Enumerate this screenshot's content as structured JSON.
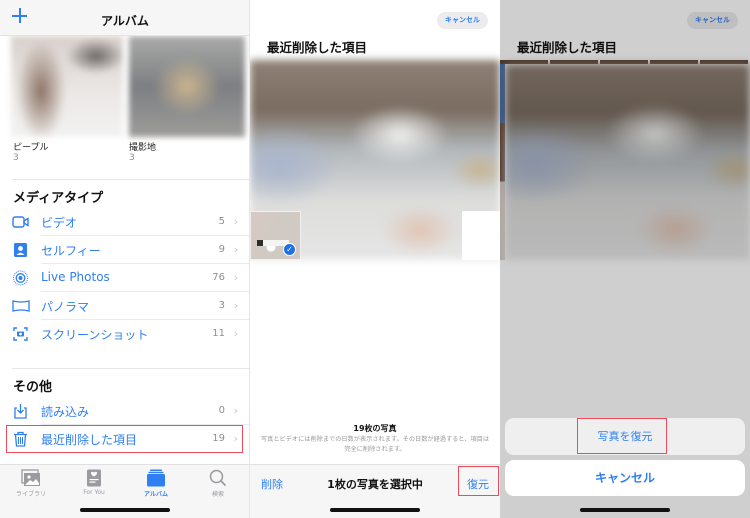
{
  "panel1": {
    "nav": {
      "title": "アルバム",
      "add_icon": "plus-icon"
    },
    "albums": [
      {
        "label": "ピープル",
        "count": "3"
      },
      {
        "label": "撮影地",
        "count": "3"
      }
    ],
    "media_types": {
      "title": "メディアタイプ",
      "items": [
        {
          "icon": "video-icon",
          "label": "ビデオ",
          "count": "5"
        },
        {
          "icon": "selfie-icon",
          "label": "セルフィー",
          "count": "9"
        },
        {
          "icon": "live-photos-icon",
          "label": "Live Photos",
          "count": "76"
        },
        {
          "icon": "panorama-icon",
          "label": "パノラマ",
          "count": "3"
        },
        {
          "icon": "screenshot-icon",
          "label": "スクリーンショット",
          "count": "11"
        }
      ]
    },
    "other": {
      "title": "その他",
      "items": [
        {
          "icon": "import-icon",
          "label": "読み込み",
          "count": "0"
        },
        {
          "icon": "trash-icon",
          "label": "最近削除した項目",
          "count": "19",
          "highlighted": true
        }
      ]
    },
    "tabbar": [
      {
        "icon": "library-icon",
        "label": "ライブラリ",
        "active": false
      },
      {
        "icon": "for-you-icon",
        "label": "For You",
        "active": false
      },
      {
        "icon": "albums-icon",
        "label": "アルバム",
        "active": true
      },
      {
        "icon": "search-icon",
        "label": "検索",
        "active": false
      }
    ],
    "chevron": "›"
  },
  "panel2": {
    "cancel_label": "キャンセル",
    "title": "最近削除した項目",
    "selected_check": "✓",
    "summary_title": "19枚の写真",
    "summary_text": "写真とビデオには削除までの日数が表示されます。その日数が経過すると、項目は完全に削除されます。",
    "toolbar": {
      "delete_label": "削除",
      "selection_label": "1枚の写真を選択中",
      "restore_label": "復元"
    }
  },
  "panel3": {
    "cancel_label": "キャンセル",
    "title": "最近削除した項目",
    "action_sheet": {
      "restore_label": "写真を復元",
      "cancel_label": "キャンセル"
    }
  },
  "colors": {
    "accent": "#2f7ff2",
    "highlight_box": "#ef4b5a",
    "secondary_text": "#8e8e93"
  }
}
